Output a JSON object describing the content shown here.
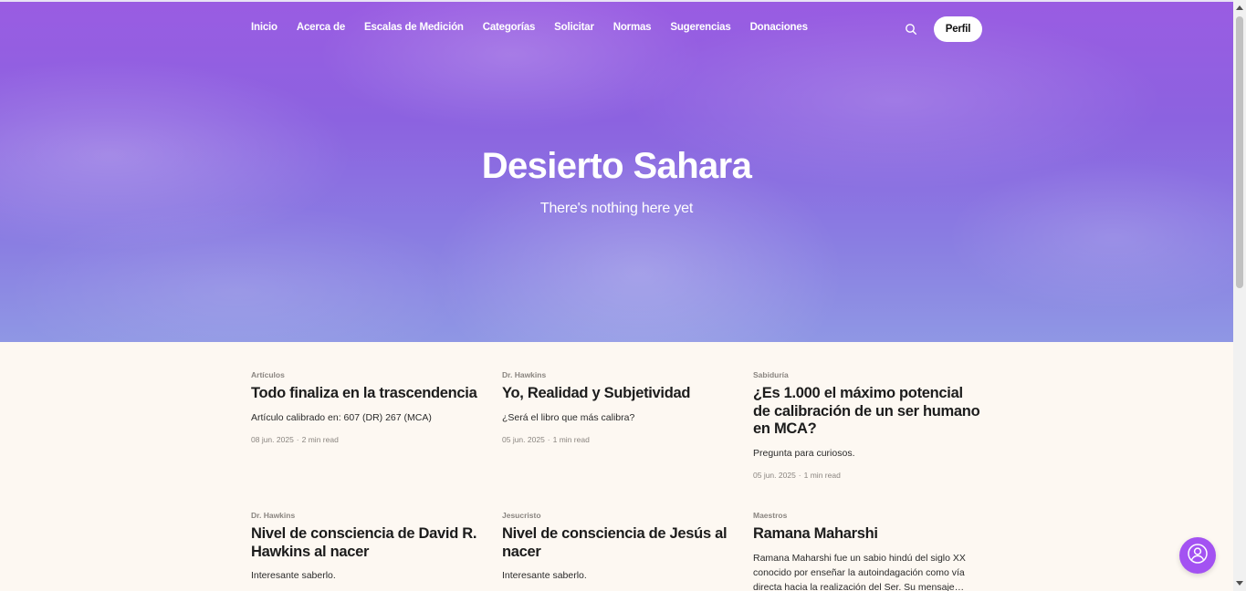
{
  "nav": {
    "items": [
      {
        "label": "Inicio"
      },
      {
        "label": "Acerca de"
      },
      {
        "label": "Escalas de Medición"
      },
      {
        "label": "Categorías"
      },
      {
        "label": "Solicitar"
      },
      {
        "label": "Normas"
      },
      {
        "label": "Sugerencias"
      },
      {
        "label": "Donaciones"
      }
    ],
    "profile_label": "Perfil"
  },
  "hero": {
    "title": "Desierto Sahara",
    "subtitle": "There's nothing here yet"
  },
  "posts": [
    {
      "category": "Artículos",
      "title": "Todo finaliza en la trascendencia",
      "excerpt": "Artículo calibrado en: 607 (DR) 267 (MCA)",
      "date": "08 jun. 2025",
      "read_time": "2 min read"
    },
    {
      "category": "Dr. Hawkins",
      "title": "Yo, Realidad y Subjetividad",
      "excerpt": "¿Será el libro que más calibra?",
      "date": "05 jun. 2025",
      "read_time": "1 min read"
    },
    {
      "category": "Sabiduría",
      "title": "¿Es 1.000 el máximo potencial de calibración de un ser humano en MCA?",
      "excerpt": "Pregunta para curiosos.",
      "date": "05 jun. 2025",
      "read_time": "1 min read"
    },
    {
      "category": "Dr. Hawkins",
      "title": "Nivel de consciencia de David R. Hawkins al nacer",
      "excerpt": "Interesante saberlo."
    },
    {
      "category": "Jesucristo",
      "title": "Nivel de consciencia de Jesús al nacer",
      "excerpt": "Interesante saberlo."
    },
    {
      "category": "Maestros",
      "title": "Ramana Maharshi",
      "excerpt": "Ramana Maharshi fue un sabio hindú del siglo XX conocido por enseñar la autoindagación como vía directa hacia la realización del Ser. Su mensaje…"
    }
  ],
  "colors": {
    "hero_top": "#9a5ce2",
    "hero_bottom": "#8f97e4",
    "page_bg": "#fdf8f2",
    "fab": "#a352f2"
  },
  "icons": {
    "search": "search-icon",
    "chat": "chat-user-icon"
  }
}
